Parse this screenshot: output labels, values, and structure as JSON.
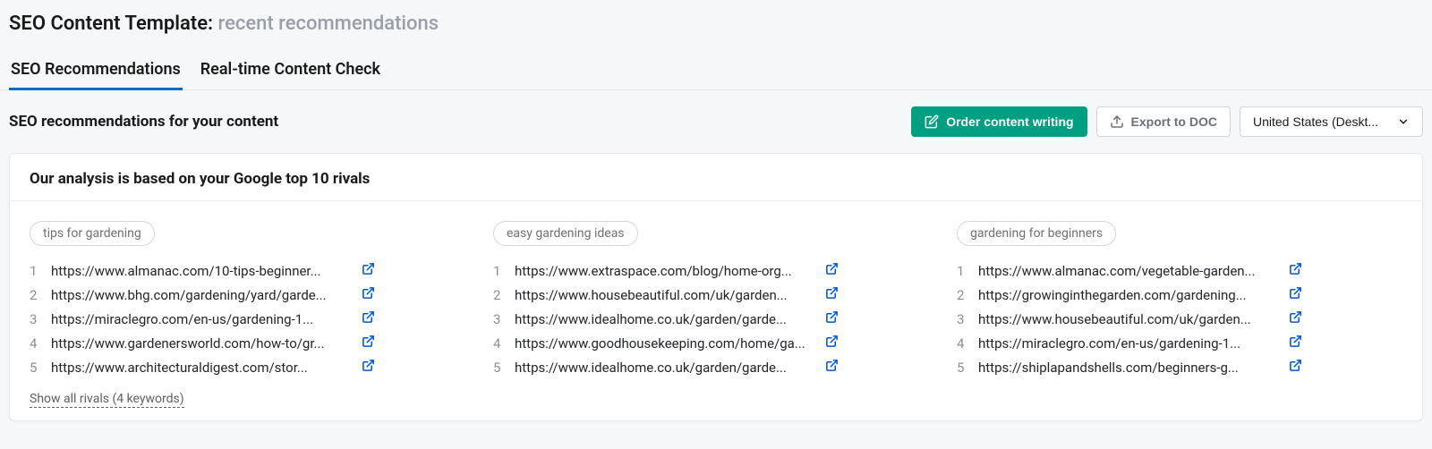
{
  "breadcrumb": {
    "title": "SEO Content Template:",
    "sub": "recent recommendations"
  },
  "tabs": [
    {
      "label": "SEO Recommendations",
      "active": true
    },
    {
      "label": "Real-time Content Check",
      "active": false
    }
  ],
  "section_title": "SEO recommendations for your content",
  "buttons": {
    "order": "Order content writing",
    "export": "Export to DOC",
    "region": "United States (Deskt..."
  },
  "card_title": "Our analysis is based on your Google top 10 rivals",
  "show_all": "Show all rivals (4 keywords)",
  "columns": [
    {
      "keyword": "tips for gardening",
      "rivals": [
        {
          "n": "1",
          "url": "https://www.almanac.com/10-tips-beginner..."
        },
        {
          "n": "2",
          "url": "https://www.bhg.com/gardening/yard/garde..."
        },
        {
          "n": "3",
          "url": "https://miraclegro.com/en-us/gardening-1..."
        },
        {
          "n": "4",
          "url": "https://www.gardenersworld.com/how-to/gr..."
        },
        {
          "n": "5",
          "url": "https://www.architecturaldigest.com/stor..."
        }
      ]
    },
    {
      "keyword": "easy gardening ideas",
      "rivals": [
        {
          "n": "1",
          "url": "https://www.extraspace.com/blog/home-org..."
        },
        {
          "n": "2",
          "url": "https://www.housebeautiful.com/uk/garden..."
        },
        {
          "n": "3",
          "url": "https://www.idealhome.co.uk/garden/garde..."
        },
        {
          "n": "4",
          "url": "https://www.goodhousekeeping.com/home/ga..."
        },
        {
          "n": "5",
          "url": "https://www.idealhome.co.uk/garden/garde..."
        }
      ]
    },
    {
      "keyword": "gardening for beginners",
      "rivals": [
        {
          "n": "1",
          "url": "https://www.almanac.com/vegetable-garden..."
        },
        {
          "n": "2",
          "url": "https://growinginthegarden.com/gardening..."
        },
        {
          "n": "3",
          "url": "https://www.housebeautiful.com/uk/garden..."
        },
        {
          "n": "4",
          "url": "https://miraclegro.com/en-us/gardening-1..."
        },
        {
          "n": "5",
          "url": "https://shiplapandshells.com/beginners-g..."
        }
      ]
    }
  ]
}
